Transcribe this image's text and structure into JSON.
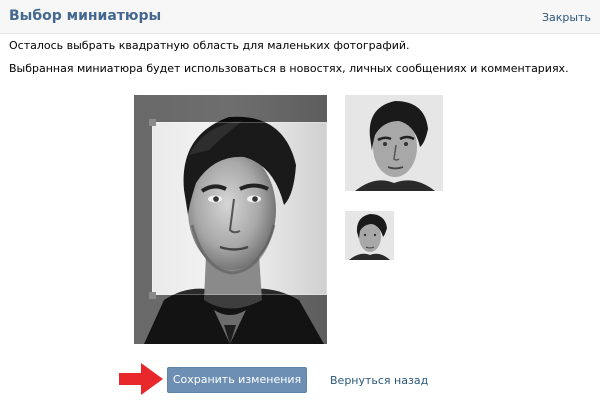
{
  "dialog": {
    "title": "Выбор миниатюры",
    "close_label": "Закрыть",
    "description_line1": "Осталось выбрать квадратную область для маленьких фотографий.",
    "description_line2": "Выбранная миниатюра будет использоваться в новостях, личных сообщениях и комментариях."
  },
  "footer": {
    "save_label": "Сохранить изменения",
    "back_label": "Вернуться назад"
  },
  "icons": {
    "arrow": "red-arrow-icon"
  },
  "colors": {
    "title": "#45688e",
    "link": "#2b587a",
    "button": "#6d8fb3",
    "arrow": "#e8282b"
  }
}
